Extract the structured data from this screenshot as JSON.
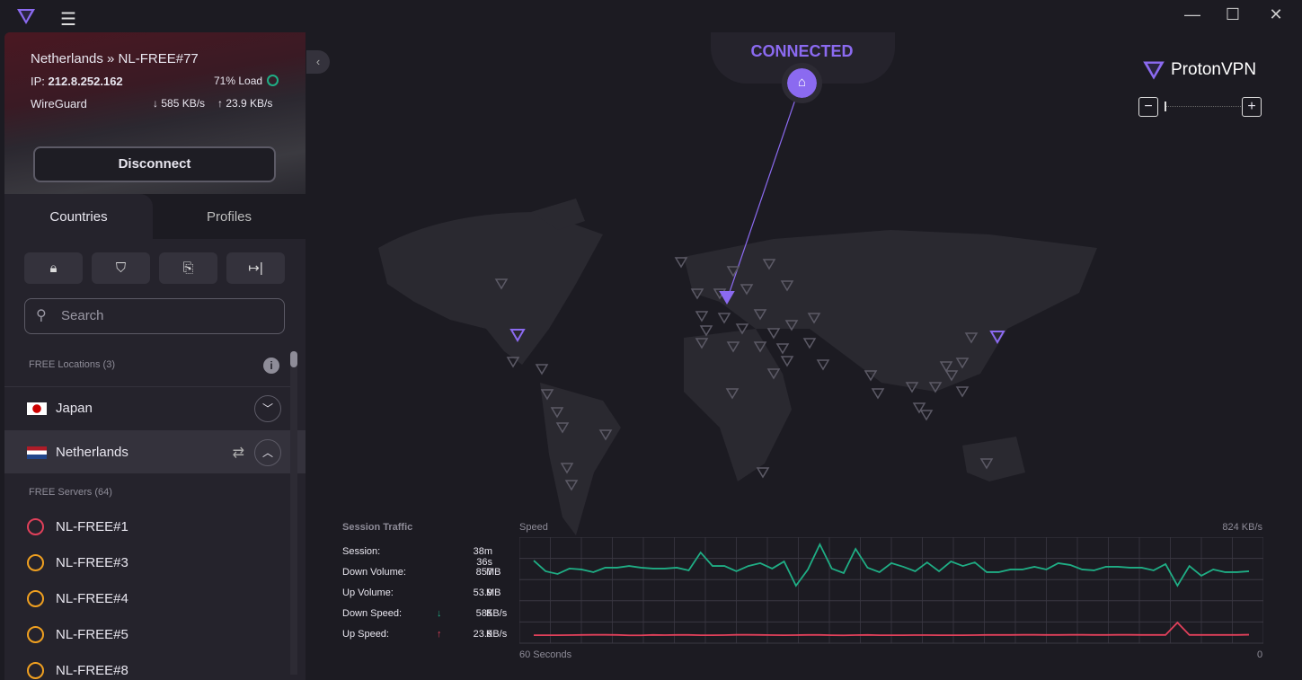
{
  "window": {
    "menu_icon": "hamburger-icon",
    "minimize": "—",
    "maximize": "☐",
    "close": "✕"
  },
  "connection": {
    "location": "Netherlands » NL-FREE#77",
    "ip_label": "IP:",
    "ip": "212.8.252.162",
    "load": "71% Load",
    "load_pct": 71,
    "protocol": "WireGuard",
    "down": "585 KB/s",
    "up": "23.9 KB/s",
    "disconnect": "Disconnect"
  },
  "tabs": {
    "countries": "Countries",
    "profiles": "Profiles"
  },
  "search": {
    "placeholder": "Search"
  },
  "free_locations": {
    "label": "FREE Locations (3)"
  },
  "countries": [
    {
      "name": "Japan"
    },
    {
      "name": "Netherlands"
    }
  ],
  "free_servers": {
    "label": "FREE Servers (64)"
  },
  "servers": [
    {
      "name": "NL-FREE#1",
      "color": "#e0405a"
    },
    {
      "name": "NL-FREE#3",
      "color": "#f0a020"
    },
    {
      "name": "NL-FREE#4",
      "color": "#f0a020"
    },
    {
      "name": "NL-FREE#5",
      "color": "#f0a020"
    },
    {
      "name": "NL-FREE#8",
      "color": "#f0a020"
    }
  ],
  "status": {
    "text": "CONNECTED",
    "accent": "#8b6af0"
  },
  "brand": {
    "name": "ProtonVPN"
  },
  "zoom": {
    "minus": "−",
    "plus": "+"
  },
  "traffic": {
    "title": "Session Traffic",
    "rows": [
      {
        "label": "Session:",
        "value": "38m 36s",
        "unit": ""
      },
      {
        "label": "Down Volume:",
        "value": "857",
        "unit": "MB"
      },
      {
        "label": "Up Volume:",
        "value": "53.9",
        "unit": "MB"
      },
      {
        "label": "Down Speed:",
        "value": "585",
        "unit": "KB/s",
        "arrow": "↓"
      },
      {
        "label": "Up Speed:",
        "value": "23.9",
        "unit": "KB/s",
        "arrow": "↑"
      }
    ]
  },
  "chart_data": {
    "type": "line",
    "title": "Speed",
    "ymax_label": "824 KB/s",
    "ylim": [
      0,
      824
    ],
    "xlabel_left": "60 Seconds",
    "xlabel_right": "0",
    "series": [
      {
        "name": "Download",
        "color": "#1fae85",
        "values": [
          642,
          559,
          538,
          580,
          573,
          552,
          587,
          587,
          600,
          587,
          580,
          580,
          587,
          566,
          705,
          600,
          600,
          559,
          600,
          622,
          580,
          635,
          447,
          573,
          768,
          580,
          545,
          733,
          587,
          552,
          622,
          594,
          559,
          628,
          559,
          635,
          600,
          628,
          552,
          552,
          573,
          573,
          594,
          573,
          622,
          608,
          573,
          566,
          594,
          594,
          587,
          587,
          566,
          615,
          447,
          600,
          524,
          573,
          552,
          552,
          559
        ]
      },
      {
        "name": "Upload",
        "color": "#e0405a",
        "values": [
          62,
          62,
          62,
          63,
          64,
          65,
          65,
          64,
          61,
          61,
          64,
          63,
          64,
          64,
          62,
          62,
          63,
          65,
          65,
          64,
          63,
          62,
          63,
          64,
          64,
          62,
          61,
          63,
          64,
          62,
          62,
          62,
          63,
          63,
          62,
          62,
          62,
          63,
          64,
          64,
          64,
          65,
          65,
          64,
          64,
          65,
          65,
          64,
          64,
          65,
          65,
          64,
          64,
          64,
          160,
          64,
          64,
          64,
          64,
          64,
          66
        ]
      }
    ]
  }
}
